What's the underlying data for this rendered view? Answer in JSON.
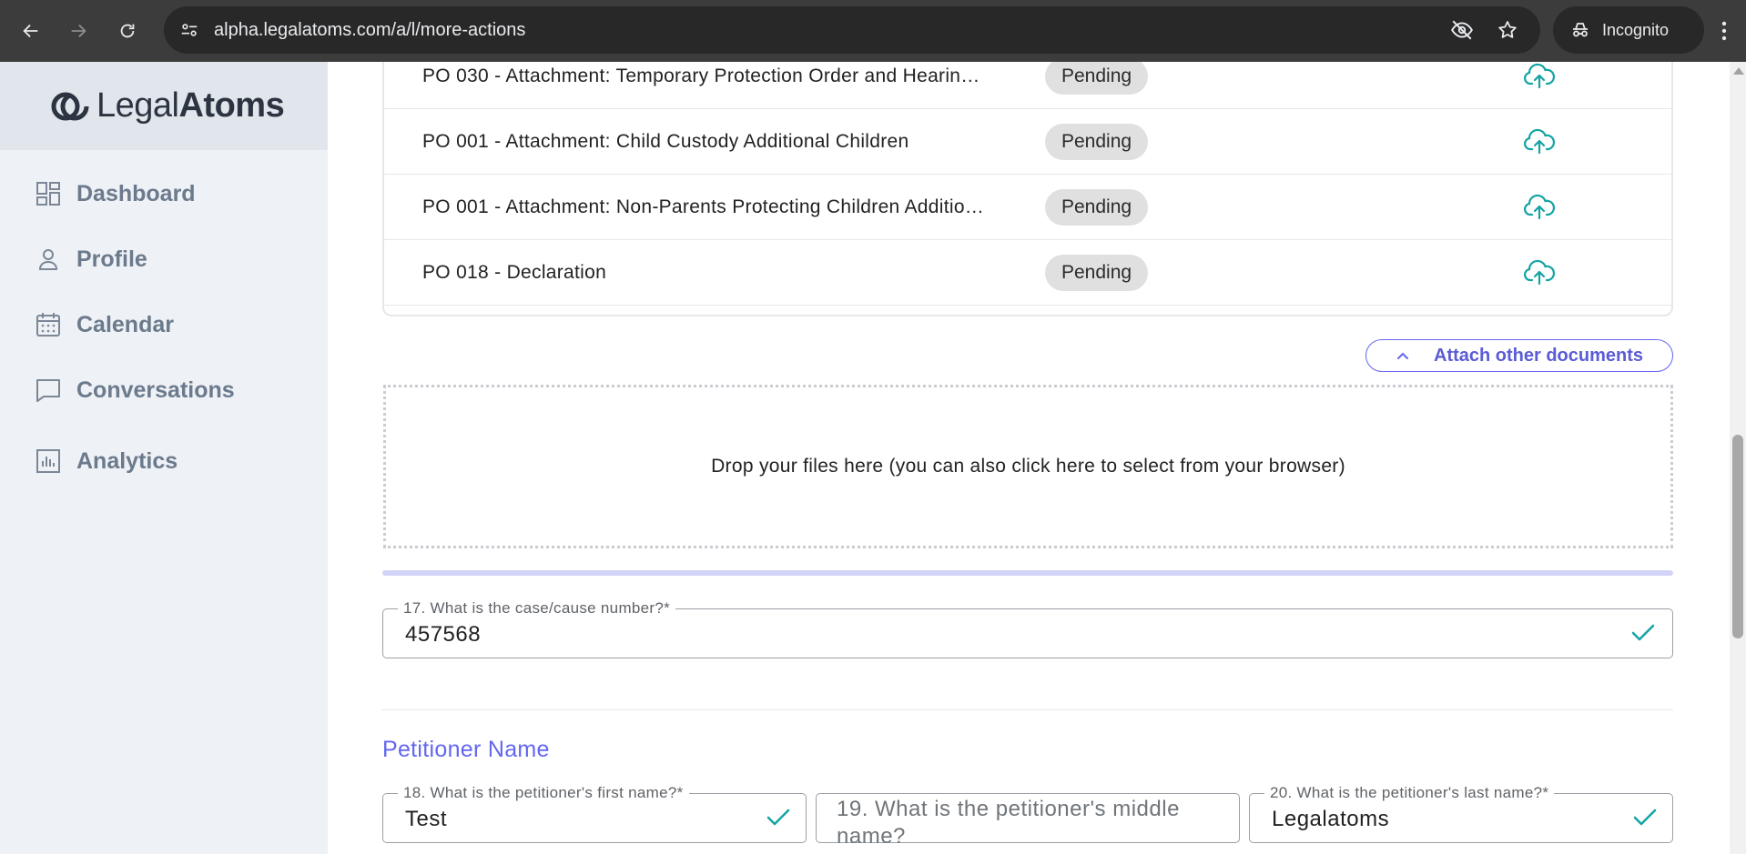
{
  "browser": {
    "url": "alpha.legalatoms.com/a/l/more-actions",
    "profile_label": "Incognito",
    "icons": [
      "back-arrow-icon",
      "forward-arrow-icon",
      "reload-icon",
      "site-info-icon",
      "eye-off-icon",
      "star-icon",
      "incognito-icon",
      "menu-dots-icon"
    ]
  },
  "sidebar": {
    "logo": {
      "light": "Legal",
      "bold": "Atoms"
    },
    "items": [
      {
        "label": "Dashboard",
        "icon": "dashboard-icon"
      },
      {
        "label": "Profile",
        "icon": "user-icon"
      },
      {
        "label": "Calendar",
        "icon": "calendar-icon"
      },
      {
        "label": "Conversations",
        "icon": "chat-icon"
      },
      {
        "label": "Analytics",
        "icon": "analytics-icon"
      }
    ]
  },
  "documents": {
    "rows": [
      {
        "name": "PO 030 - Attachment: Temporary Protection Order and Hearin…",
        "status": "Pending"
      },
      {
        "name": "PO 001 - Attachment: Child Custody Additional Children",
        "status": "Pending"
      },
      {
        "name": "PO 001 - Attachment: Non-Parents Protecting Children Additio…",
        "status": "Pending"
      },
      {
        "name": "PO 018 - Declaration",
        "status": "Pending"
      }
    ],
    "attach_label": "Attach other documents",
    "dropzone_text": "Drop your files here (you can also click here to select from your browser)"
  },
  "form": {
    "case_number": {
      "label": "17. What is the case/cause number?*",
      "value": "457568"
    },
    "section_title": "Petitioner Name",
    "first_name": {
      "label": "18. What is the petitioner's first name?*",
      "value": "Test"
    },
    "middle_name": {
      "placeholder": "19. What is the petitioner's middle name?"
    },
    "last_name": {
      "label": "20. What is the petitioner's last name?*",
      "value": "Legalatoms"
    }
  },
  "colors": {
    "accent": "#6366f1",
    "teal": "#14a3a3",
    "sidebar_bg": "#eef1f5",
    "chrome_bg": "#3c3c3c"
  }
}
